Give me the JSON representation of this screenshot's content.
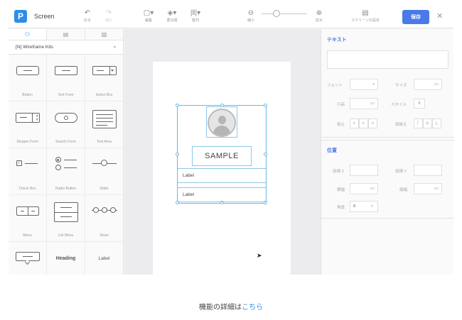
{
  "app": {
    "logo": "P",
    "title": "Screen"
  },
  "toolbar": {
    "undo": {
      "icon": "↶",
      "label": "戻る"
    },
    "redo": {
      "icon": "↷",
      "label": "進む"
    },
    "edit": {
      "icon": "▢▾",
      "label": "編集"
    },
    "layer": {
      "icon": "◈▾",
      "label": "重ね順"
    },
    "align": {
      "icon": "|‖|▾",
      "label": "整列"
    },
    "zoom_out": {
      "icon": "⊖",
      "label": "縮小"
    },
    "zoom_in": {
      "icon": "⊕",
      "label": "拡大"
    },
    "screen_settings": {
      "icon": "▤",
      "label": "スクリーンの設定"
    },
    "save_label": "保存",
    "close": "✕"
  },
  "left_panel": {
    "tabs": [
      {
        "icon": "⚇"
      },
      {
        "icon": "▤"
      },
      {
        "icon": "▨"
      }
    ],
    "kit_label": "[N] Wireframe Kits",
    "kit_arrow": "▾",
    "items": [
      {
        "label": "Button"
      },
      {
        "label": "Text Form"
      },
      {
        "label": "Select Box"
      },
      {
        "label": "Stepper Form"
      },
      {
        "label": "Search Form"
      },
      {
        "label": "Text Area"
      },
      {
        "label": "Check Box"
      },
      {
        "label": "Radio Button"
      },
      {
        "label": "Slider"
      },
      {
        "label": "Menu"
      },
      {
        "label": "List Menu"
      },
      {
        "label": "Steps"
      },
      {
        "label": ""
      },
      {
        "label": "Heading"
      },
      {
        "label": "Label"
      }
    ]
  },
  "canvas": {
    "sample_text": "SAMPLE",
    "label_1": "Label",
    "label_2": "Label"
  },
  "right_panel": {
    "text_section": {
      "title": "テキスト",
      "font_label": "フォント",
      "size_label": "サイズ",
      "size_unit": "px",
      "line_label": "行高",
      "line_unit": "px",
      "style_label": "スタイル",
      "style_bold": "B",
      "align_h_label": "揃え",
      "align_v_label": "縦揃え",
      "font_arrow": "▾"
    },
    "position_section": {
      "title": "位置",
      "x_label": "座標 X",
      "y_label": "座標 Y",
      "width_label": "横幅",
      "width_unit": "px",
      "height_label": "縦幅",
      "height_unit": "px",
      "angle_label": "角度",
      "angle_value": "0",
      "angle_arrow": "▾"
    }
  },
  "footer": {
    "text": "機能の詳細は",
    "link": "こちら"
  },
  "colors": {
    "accent": "#4a7ae8",
    "selection": "#6bb8e0",
    "canvas_bg": "#ececee"
  }
}
